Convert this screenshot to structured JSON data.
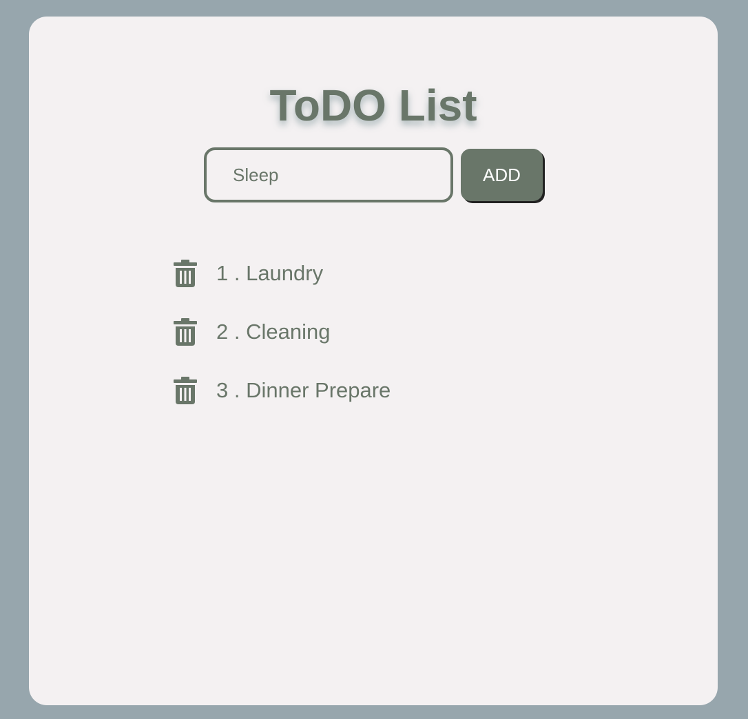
{
  "app": {
    "title": "ToDO List"
  },
  "form": {
    "input_value": "Sleep",
    "add_label": "ADD"
  },
  "todos": [
    {
      "text": "1 . Laundry",
      "icon": "trash-icon"
    },
    {
      "text": "2 . Cleaning",
      "icon": "trash-icon"
    },
    {
      "text": "3 . Dinner Prepare",
      "icon": "trash-icon"
    }
  ],
  "colors": {
    "page_background": "#97a6ad",
    "card_background": "#f4f1f2",
    "accent": "#697669",
    "button_text": "#ffffff"
  }
}
